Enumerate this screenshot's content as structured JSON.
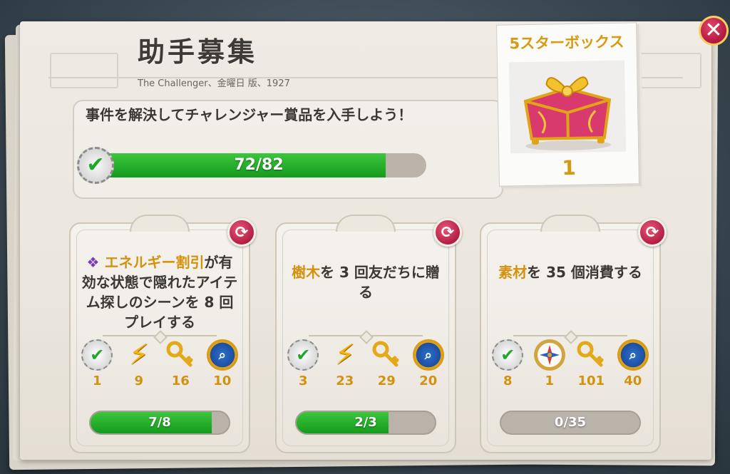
{
  "header": {
    "title": "助手募集",
    "subtitle": "The Challenger、金曜日 版、1927"
  },
  "quest": {
    "text": "事件を解決してチャレンジャー賞品を入手しよう！",
    "progress_label": "72/82",
    "progress": 0.878
  },
  "reward": {
    "title": "5スターボックス",
    "count": "1",
    "icon": "gift-box-icon"
  },
  "tasks": [
    {
      "icon": "energy-discount-icon",
      "highlight": "エネルギー割引",
      "text": "が有効な状態で隠れたアイテム探しのシーンを 8 回プレイする",
      "rewards": [
        {
          "icon": "check-badge-icon",
          "value": "1"
        },
        {
          "icon": "lightning-icon",
          "value": "9"
        },
        {
          "icon": "key-icon",
          "value": "16"
        },
        {
          "icon": "magnifier-seal-icon",
          "value": "10"
        }
      ],
      "progress_label": "7/8",
      "progress": 0.875
    },
    {
      "highlight": "樹木",
      "text": "を 3 回友だちに贈る",
      "rewards": [
        {
          "icon": "check-badge-icon",
          "value": "3"
        },
        {
          "icon": "lightning-icon",
          "value": "23"
        },
        {
          "icon": "key-icon",
          "value": "29"
        },
        {
          "icon": "magnifier-seal-icon",
          "value": "20"
        }
      ],
      "progress_label": "2/3",
      "progress": 0.667
    },
    {
      "highlight": "素材",
      "text": "を 35 個消費する",
      "rewards": [
        {
          "icon": "check-badge-icon",
          "value": "8"
        },
        {
          "icon": "compass-icon",
          "value": "1"
        },
        {
          "icon": "key-icon",
          "value": "101"
        },
        {
          "icon": "magnifier-seal-icon",
          "value": "40"
        }
      ],
      "progress_label": "0/35",
      "progress": 0
    }
  ],
  "colors": {
    "accent": "#d3920e",
    "progress_green": "#1fa82a",
    "close_red": "#c21e47"
  }
}
